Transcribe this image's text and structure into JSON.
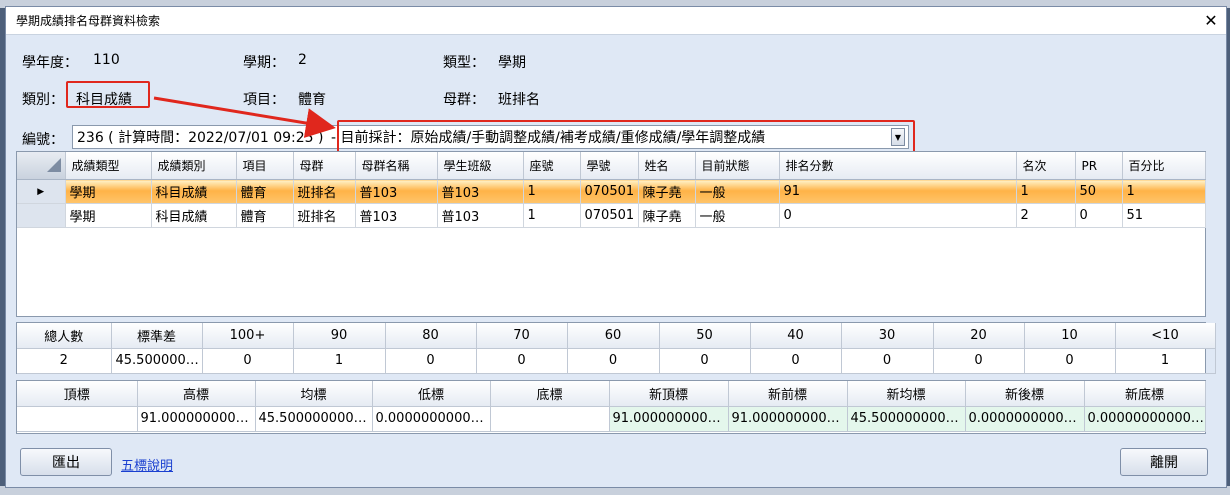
{
  "window": {
    "title": "學期成績排名母群資料檢索",
    "close_glyph": "✕"
  },
  "info": {
    "school_year_label": "學年度：",
    "school_year": "110",
    "semester_label": "學期：",
    "semester": "2",
    "type_label": "類型：",
    "type": "學期",
    "category_label": "類別：",
    "category": "科目成績",
    "item_label": "項目：",
    "item": "體育",
    "population_label": "母群：",
    "population": "班排名"
  },
  "number": {
    "label": "編號：",
    "value": "236 ( 計算時間：2022/07/01 09:25 ) - 目前採計：原始成績/手動調整成績/補考成績/重修成績/學年調整成績",
    "value_left": "236 ( 計算時間：2022/07/01 09:25 )",
    "value_right": "- 目前採計：原始成績/手動調整成績/補考成績/重修成績/學年調整成績"
  },
  "grid": {
    "columns": [
      "成績類型",
      "成績類別",
      "項目",
      "母群",
      "母群名稱",
      "學生班級",
      "座號",
      "學號",
      "姓名",
      "目前狀態",
      "排名分數",
      "名次",
      "PR",
      "百分比"
    ],
    "rows": [
      [
        "學期",
        "科目成績",
        "體育",
        "班排名",
        "普103",
        "普103",
        "1",
        "070501",
        "陳子堯",
        "一般",
        "91",
        "1",
        "50",
        "1"
      ],
      [
        "學期",
        "科目成績",
        "體育",
        "班排名",
        "普103",
        "普103",
        "1",
        "070501",
        "陳子堯",
        "一般",
        "0",
        "2",
        "0",
        "51"
      ]
    ],
    "selected_row_marker": "▶"
  },
  "stats": {
    "headers": [
      "總人數",
      "標準差",
      "100+",
      "90",
      "80",
      "70",
      "60",
      "50",
      "40",
      "30",
      "20",
      "10",
      "<10"
    ],
    "values": [
      "2",
      "45.500000…",
      "0",
      "1",
      "0",
      "0",
      "0",
      "0",
      "0",
      "0",
      "0",
      "0",
      "1"
    ]
  },
  "five_marks": {
    "headers": [
      "頂標",
      "高標",
      "均標",
      "低標",
      "底標",
      "新頂標",
      "新前標",
      "新均標",
      "新後標",
      "新底標"
    ],
    "values": [
      "",
      "91.0000000000…",
      "45.5000000000…",
      "0.00000000000…",
      "",
      "91.0000000000…",
      "91.0000000000…",
      "45.5000000000…",
      "0.00000000000…",
      "0.00000000000…"
    ]
  },
  "footer": {
    "export_label": "匯出",
    "help_link": "五標說明",
    "close_label": "離開"
  },
  "colors": {
    "highlight_border": "#e0271d",
    "selected_row": "#ffb347",
    "link": "#1a3fd0"
  }
}
